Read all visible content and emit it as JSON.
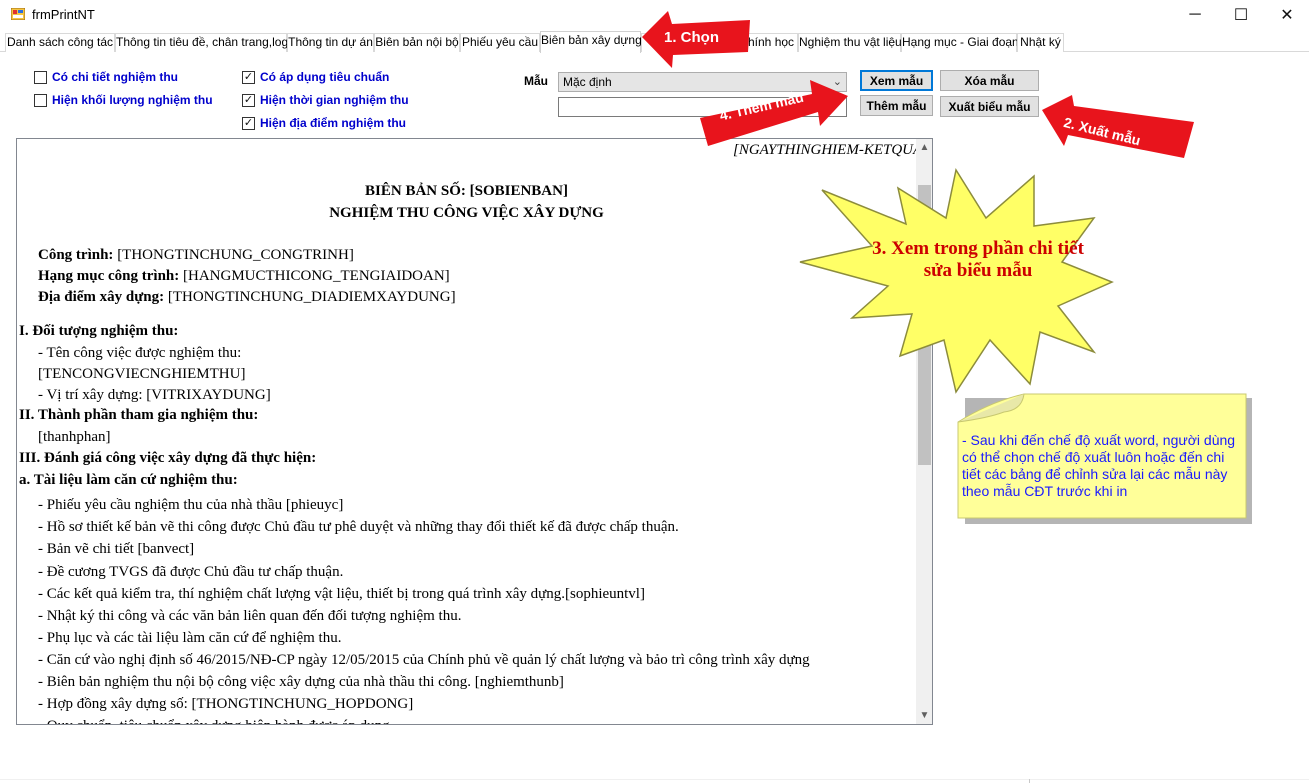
{
  "window": {
    "title": "frmPrintNT",
    "minimize": "─",
    "maximize": "☐",
    "close": "✕"
  },
  "tabs": [
    "Danh sách công tác",
    "Thông tin tiêu đề, chân trang,logo",
    "Thông tin dự án",
    "Biên bản nội bộ",
    "Phiếu yêu cầu",
    "Biên bản xây dựng",
    "",
    "chính học",
    "Nghiệm thu vật liệu",
    "Hạng mục - Giai đoạn",
    "Nhật ký"
  ],
  "options": {
    "chi_tiet": {
      "label": "Có chi tiết nghiệm thu",
      "checked": false
    },
    "khoi_luong": {
      "label": "Hiện khối lượng nghiệm thu",
      "checked": false
    },
    "tieu_chuan": {
      "label": "Có áp dụng tiêu chuẩn",
      "checked": true
    },
    "thoi_gian": {
      "label": "Hiện thời gian nghiệm thu",
      "checked": true
    },
    "dia_diem": {
      "label": "Hiện địa điểm nghiệm thu",
      "checked": true
    }
  },
  "template": {
    "label": "Mẫu",
    "selected": "Mặc định",
    "name_value": ""
  },
  "buttons": {
    "preview": "Xem mẫu",
    "delete": "Xóa mẫu",
    "add": "Thêm mẫu",
    "export": "Xuất biểu mẫu"
  },
  "document": {
    "header_right": "[NGAYTHINGHIEM-KETQUA]",
    "title1": "BIÊN BẢN SỐ: [SOBIENBAN]",
    "title2": "NGHIỆM THU CÔNG VIỆC XÂY DỰNG",
    "cong_trinh_label": "Công trình:",
    "cong_trinh_value": " [THONGTINCHUNG_CONGTRINH]",
    "hang_muc_label": "Hạng mục công trình:",
    "hang_muc_value": " [HANGMUCTHICONG_TENGIAIDOAN]",
    "dia_diem_label": "Địa điểm xây dựng:",
    "dia_diem_value": " [THONGTINCHUNG_DIADIEMXAYDUNG]",
    "s1": "I. Đối tượng nghiệm thu:",
    "s1_l1": "- Tên công việc được nghiệm thu:",
    "s1_l2": "[TENCONGVIECNGHIEMTHU]",
    "s1_l3": "- Vị trí xây dựng: [VITRIXAYDUNG]",
    "s2": "II. Thành phần tham gia nghiệm thu:",
    "s2_l1": "[thanhphan]",
    "s3": "III. Đánh giá công việc xây dựng đã thực hiện:",
    "s3a": "a. Tài liệu làm căn cứ nghiệm thu:",
    "items": [
      "- Phiếu yêu cầu nghiệm thu của nhà thầu [phieuyc]",
      "- Hồ sơ thiết kế bản vẽ thi công được Chủ đầu tư phê duyệt và những thay đổi thiết kế đã được chấp thuận.",
      "- Bản vẽ chi tiết [banvect]",
      "- Đề cương TVGS đã được Chủ đầu tư chấp thuận.",
      "- Các kết quả kiểm tra, thí nghiệm chất lượng vật liệu, thiết bị trong quá trình xây dựng.[sophieuntvl]",
      "- Nhật ký thi công và các văn bản liên quan đến đối tượng nghiệm thu.",
      "- Phụ lục và các tài liệu làm căn cứ để nghiệm thu.",
      "- Căn cứ vào nghị định số 46/2015/NĐ-CP ngày 12/05/2015 của Chính phủ về quản lý chất lượng và bảo trì công trình xây dựng",
      "- Biên bản nghiệm thu nội bộ công việc xây dựng của nhà thầu thi công. [nghiemthunb]",
      "- Hợp đồng xây dựng số: [THONGTINCHUNG_HOPDONG]",
      "- Quy chuẩn, tiêu chuẩn xây dựng hiện hành được áp dụng."
    ]
  },
  "annotations": {
    "step1": "1. Chọn",
    "step2": "2. Xuất mẫu",
    "step3": "3. Xem trong phần chi tiết sửa biểu mẫu",
    "step4": "4. Thêm mẫu",
    "note": "- Sau khi đến chế độ xuất word, người dùng có thể chọn chế độ xuất luôn hoặc đến chi tiết các bảng để chỉnh sửa lại các mẫu này theo mẫu CĐT trước khi in",
    "arrow_color": "#e8141c",
    "burst_color": "#ffff66",
    "note_color": "#ffff99"
  }
}
